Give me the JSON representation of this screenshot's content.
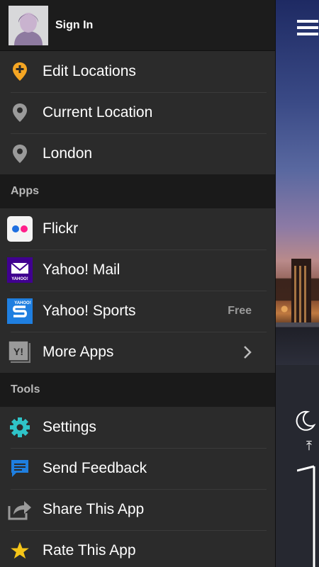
{
  "header": {
    "sign_in": "Sign In"
  },
  "locations": [
    {
      "label": "Edit Locations",
      "icon": "pin-plus-icon"
    },
    {
      "label": "Current Location",
      "icon": "pin-icon"
    },
    {
      "label": "London",
      "icon": "pin-icon"
    }
  ],
  "apps_section": "Apps",
  "apps": [
    {
      "label": "Flickr",
      "icon": "flickr-icon"
    },
    {
      "label": "Yahoo! Mail",
      "icon": "yahoo-mail-icon",
      "icon_text": "YAHOO!"
    },
    {
      "label": "Yahoo! Sports",
      "icon": "yahoo-sports-icon",
      "badge": "Free",
      "icon_text": "YAHOO!"
    },
    {
      "label": "More Apps",
      "icon": "yahoo-more-apps-icon"
    }
  ],
  "tools_section": "Tools",
  "tools": [
    {
      "label": "Settings",
      "icon": "gear-icon"
    },
    {
      "label": "Send Feedback",
      "icon": "feedback-icon"
    },
    {
      "label": "Share This App",
      "icon": "share-icon"
    },
    {
      "label": "Rate This App",
      "icon": "star-icon"
    }
  ],
  "colors": {
    "accent_orange": "#f5a623",
    "teal": "#2fc3c8",
    "blue": "#1f7fe0",
    "yahoo_purple": "#400090"
  }
}
